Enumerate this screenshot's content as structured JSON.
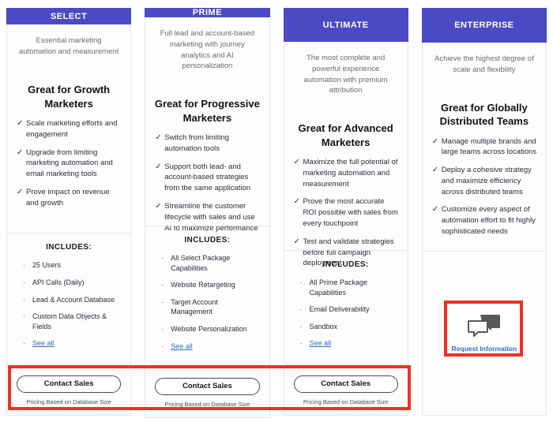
{
  "accent": {
    "header_purple": "#4a4ac4",
    "link_blue": "#2f6fc4",
    "highlight_red": "#ee3124"
  },
  "common": {
    "includes_title": "INCLUDES:",
    "see_all_label": "See all",
    "cta_label": "Contact Sales",
    "cta_note": "Pricing Based on Database Size",
    "check_glyph": "✓",
    "bullet_glyph": "·"
  },
  "plans": [
    {
      "name": "SELECT",
      "tagline": "Essential marketing automation and measurement",
      "headline": "Great for Growth Marketers",
      "benefits": [
        "Scale marketing efforts and engagement",
        "Upgrade from limiting marketing automation and email marketing tools",
        "Prove impact on revenue and growth"
      ],
      "includes": [
        "25 Users",
        "API Calls (Daily)",
        "Lead & Account Database",
        "Custom Data Objects & Fields"
      ],
      "has_see_all": true,
      "cta_type": "contact-sales"
    },
    {
      "name": "PRIME",
      "tagline": "Full lead and account-based marketing with journey analytics and AI personalization",
      "headline": "Great for Progressive Marketers",
      "benefits": [
        "Switch from limiting automation tools",
        "Support both lead- and account-based strategies from the same application",
        "Streamline the customer lifecycle with sales and use AI to maximize performance"
      ],
      "includes": [
        "All Select Package Capabilities",
        "Website Retargeting",
        "Target Account Management",
        "Website Personalization"
      ],
      "has_see_all": true,
      "cta_type": "contact-sales"
    },
    {
      "name": "ULTIMATE",
      "tagline": "The most complete and powerful experience automation with premium attribution",
      "headline": "Great for Advanced Marketers",
      "benefits": [
        "Maximize the full potential of marketing automation and measurement",
        "Prove the most accurate ROI possible with sales from every touchpoint",
        "Test and validate strategies before full campaign deployment"
      ],
      "includes": [
        "All Prime Package Capabilities",
        "Email Deliverability",
        "Sandbox"
      ],
      "has_see_all": true,
      "cta_type": "contact-sales"
    },
    {
      "name": "ENTERPRISE",
      "tagline": "Achieve the highest degree of scale and flexibility",
      "headline": "Great for Globally Distributed Teams",
      "benefits": [
        "Manage multiple brands and large teams across locations",
        "Deploy a cohesive strategy and maximize efficiency across distributed teams",
        "Customize every aspect of automation effort to fit highly sophisticated needs"
      ],
      "includes": [],
      "has_see_all": false,
      "cta_type": "request-information",
      "request_label": "Request Information"
    }
  ],
  "annotations": [
    {
      "id": "hl-cta",
      "target": "contact-sales-row"
    },
    {
      "id": "hl-req",
      "target": "request-information-button"
    }
  ]
}
